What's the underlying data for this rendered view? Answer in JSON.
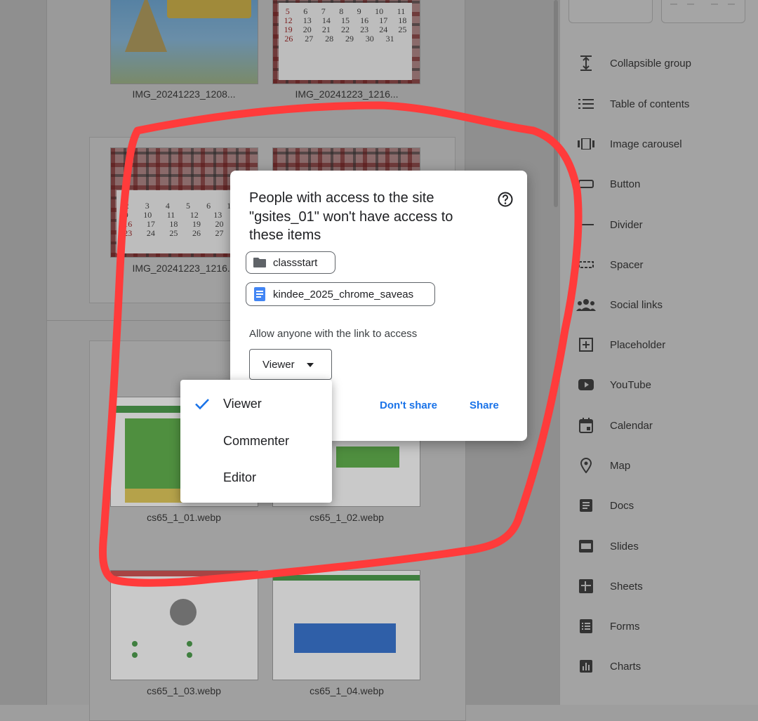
{
  "files": [
    {
      "name": "IMG_20241223_1208..."
    },
    {
      "name": "IMG_20241223_1216..."
    },
    {
      "name": "IMG_20241223_1216..."
    },
    {
      "name": "cs65_1_01.webp"
    },
    {
      "name": "cs65_1_02.webp"
    },
    {
      "name": "cs65_1_03.webp"
    },
    {
      "name": "cs65_1_04.webp"
    }
  ],
  "sidebar": {
    "items": [
      {
        "label": "Collapsible group",
        "icon": "collapsible-group-icon"
      },
      {
        "label": "Table of contents",
        "icon": "table-of-contents-icon"
      },
      {
        "label": "Image carousel",
        "icon": "image-carousel-icon"
      },
      {
        "label": "Button",
        "icon": "button-icon"
      },
      {
        "label": "Divider",
        "icon": "divider-icon"
      },
      {
        "label": "Spacer",
        "icon": "spacer-icon"
      },
      {
        "label": "Social links",
        "icon": "social-links-icon"
      },
      {
        "label": "Placeholder",
        "icon": "placeholder-icon"
      },
      {
        "label": "YouTube",
        "icon": "youtube-icon"
      },
      {
        "label": "Calendar",
        "icon": "calendar-icon"
      },
      {
        "label": "Map",
        "icon": "map-icon"
      },
      {
        "label": "Docs",
        "icon": "docs-icon"
      },
      {
        "label": "Slides",
        "icon": "slides-icon"
      },
      {
        "label": "Sheets",
        "icon": "sheets-icon"
      },
      {
        "label": "Forms",
        "icon": "forms-icon"
      },
      {
        "label": "Charts",
        "icon": "charts-icon"
      }
    ]
  },
  "dialog": {
    "title": "People with access to the site \"gsites_01\" won't have access to these items",
    "items": [
      {
        "label": "classstart",
        "icon": "folder-icon"
      },
      {
        "label": "kindee_2025_chrome_saveas",
        "icon": "docs-file-icon"
      }
    ],
    "access_label": "Allow anyone with the link to access",
    "role_selected": "Viewer",
    "dont_share_label": "Don't share",
    "share_label": "Share"
  },
  "role_menu": {
    "options": [
      {
        "label": "Viewer",
        "selected": true
      },
      {
        "label": "Commenter",
        "selected": false
      },
      {
        "label": "Editor",
        "selected": false
      }
    ]
  },
  "colors": {
    "accent": "#1a73e8",
    "annotation": "#ff3b3b",
    "scrim": "#9e9e9e"
  }
}
